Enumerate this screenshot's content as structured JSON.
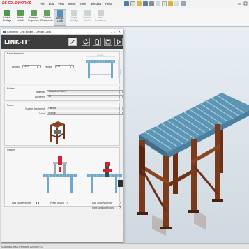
{
  "app": {
    "logo_text": "SOLIDWORKS",
    "menus": [
      "File",
      "Edit",
      "View",
      "Insert",
      "Tools",
      "Window",
      "Help"
    ]
  },
  "ribbon": {
    "buttons": [
      {
        "label": "Link-It\nSettings"
      },
      {
        "label": "About\nLink-It"
      },
      {
        "label": "Manage\nProperties"
      },
      {
        "label": "Publish\nDocuments"
      },
      {
        "label": "Design\nLogic"
      },
      {
        "label": "Apply\nSettings"
      },
      {
        "label": "Rebuild\nModel"
      },
      {
        "label": "Mass\nPublishing"
      }
    ]
  },
  "dialog": {
    "title": "Conveyor_Line.slddrm - Design Logic",
    "logo": "LINK-IT",
    "base_dimension": {
      "title": "Base dimension",
      "length_label": "Length",
      "length_value": "1250",
      "height_label": "Height",
      "height_value": "700",
      "diagram_length": "Length",
      "diagram_height": "Height"
    },
    "rollers": {
      "title": "Rollers",
      "material_label": "Material",
      "material_value": "Galvanized Steel",
      "diameter_label": "Diameter",
      "diameter_value": "32"
    },
    "frame": {
      "title": "Frame",
      "surface_label": "Surface treatment",
      "surface_value": "Painted",
      "color_label": "Color",
      "color_value": "Bronze"
    },
    "options": {
      "title": "Options",
      "add_left": "Add conveyor left",
      "add_left_checked": false,
      "press_device": "Press device",
      "press_device_checked": true,
      "add_right": "Add conveyor right",
      "add_right_checked": true,
      "overturning": "Overturning devices",
      "overturning_checked": true
    }
  },
  "status": {
    "text": "SOLIDWORKS Premium 2020 SP2.0"
  },
  "colors": {
    "frame": "#7a3a1c",
    "rollers": "#6fa9c9",
    "header": "#3d3d3d"
  }
}
